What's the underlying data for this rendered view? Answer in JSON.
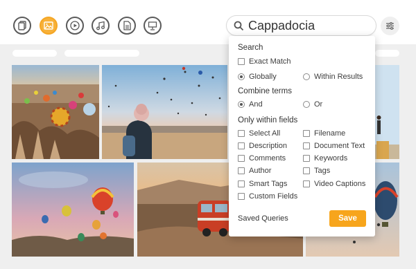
{
  "search": {
    "value": "Cappadocia"
  },
  "toolbar": {
    "icons": [
      "documents-icon",
      "images-icon",
      "video-icon",
      "audio-icon",
      "text-file-icon",
      "presentation-icon"
    ],
    "active_icon": "images-icon"
  },
  "colors": {
    "accent": "#f7a51c",
    "background": "#efefef",
    "icon_stroke": "#5a5a5a"
  },
  "panel": {
    "search_title": "Search",
    "exact_match": "Exact Match",
    "globally": "Globally",
    "within_results": "Within Results",
    "combine_title": "Combine terms",
    "and": "And",
    "or": "Or",
    "fields_title": "Only within fields",
    "fields_left": [
      "Select All",
      "Description",
      "Comments",
      "Author",
      "Smart Tags",
      "Custom Fields"
    ],
    "fields_right": [
      "Filename",
      "Document Text",
      "Keywords",
      "Tags",
      "Video Captions"
    ],
    "saved_queries": "Saved Queries",
    "save_label": "Save",
    "selected_search_scope": "Globally",
    "selected_combine": "And"
  }
}
